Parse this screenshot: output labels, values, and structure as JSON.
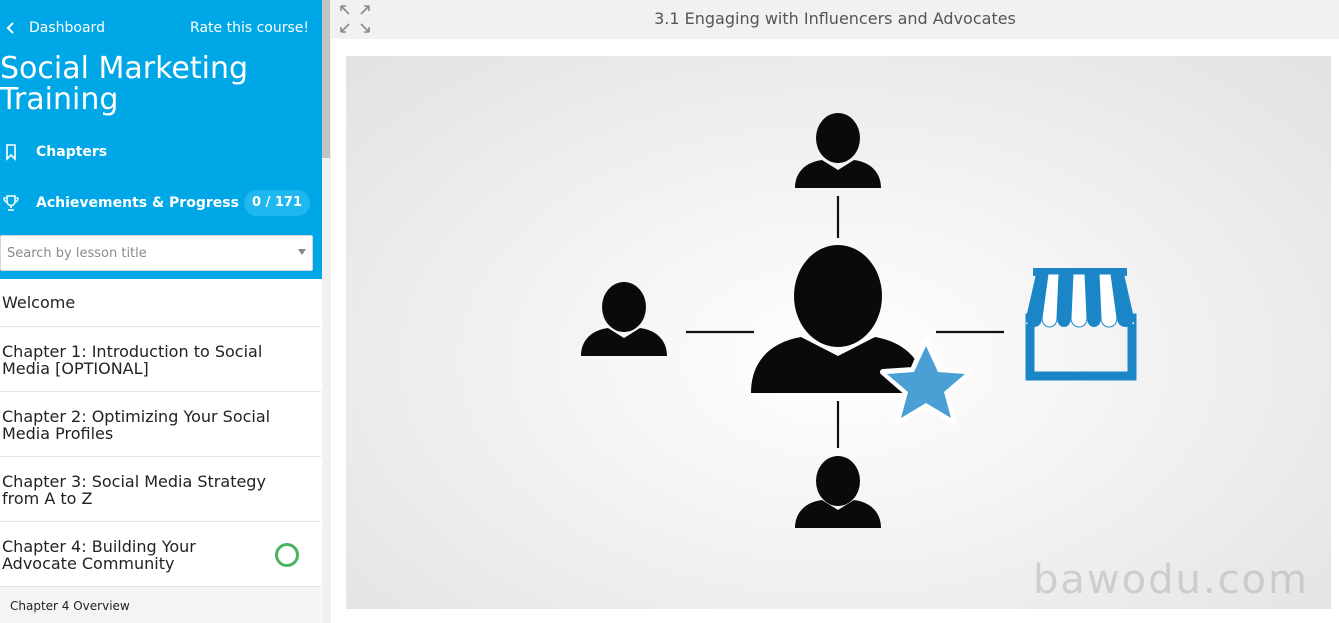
{
  "sidebar": {
    "back_label": "Dashboard",
    "rate_label": "Rate this course!",
    "course_title": "Social Marketing Training",
    "chapters_label": "Chapters",
    "achievements_label": "Achievements & Progress",
    "progress_text": "0 / 171",
    "search_placeholder": "Search by lesson title",
    "lessons": [
      {
        "label": "Welcome"
      },
      {
        "label": "Chapter 1: Introduction to Social Media [OPTIONAL]"
      },
      {
        "label": "Chapter 2: Optimizing Your Social Media Profiles"
      },
      {
        "label": "Chapter 3: Social Media Strategy from A to Z"
      },
      {
        "label": "Chapter 4: Building Your Advocate Community"
      }
    ],
    "sub_lesson": "Chapter 4 Overview"
  },
  "main": {
    "lesson_title": "3.1 Engaging with Influencers and Advocates",
    "watermark": "bawodu.com"
  },
  "colors": {
    "brand": "#00a7e6",
    "progress_ring": "#4bb35f",
    "store_blue": "#1a86c8",
    "star_blue": "#4a9fd4"
  },
  "icons": {
    "back": "chevron-left-icon",
    "chapters": "bookmark-icon",
    "achievements": "trophy-icon",
    "expand": "expand-icon",
    "status": "progress-ring-icon"
  }
}
